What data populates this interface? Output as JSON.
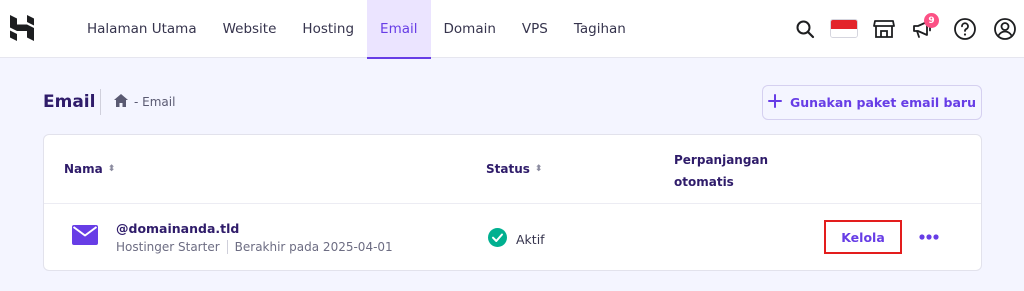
{
  "nav": {
    "items": [
      "Halaman Utama",
      "Website",
      "Hosting",
      "Email",
      "Domain",
      "VPS",
      "Tagihan"
    ],
    "active_index": 3,
    "notification_count": "9"
  },
  "page": {
    "title": "Email",
    "breadcrumb": "- Email",
    "add_button_label": "Gunakan paket email baru"
  },
  "table": {
    "columns": {
      "name": "Nama",
      "status": "Status",
      "renewal": "Perpanjangan otomatis"
    },
    "rows": [
      {
        "domain": "@domainanda.tld",
        "plan": "Hostinger Starter",
        "expiry": "Berakhir pada 2025-04-01",
        "status": "Aktif",
        "manage_label": "Kelola"
      }
    ]
  },
  "colors": {
    "accent": "#673de6",
    "success": "#00b090",
    "highlight_box": "#e31d1d",
    "badge": "#fc5185"
  }
}
